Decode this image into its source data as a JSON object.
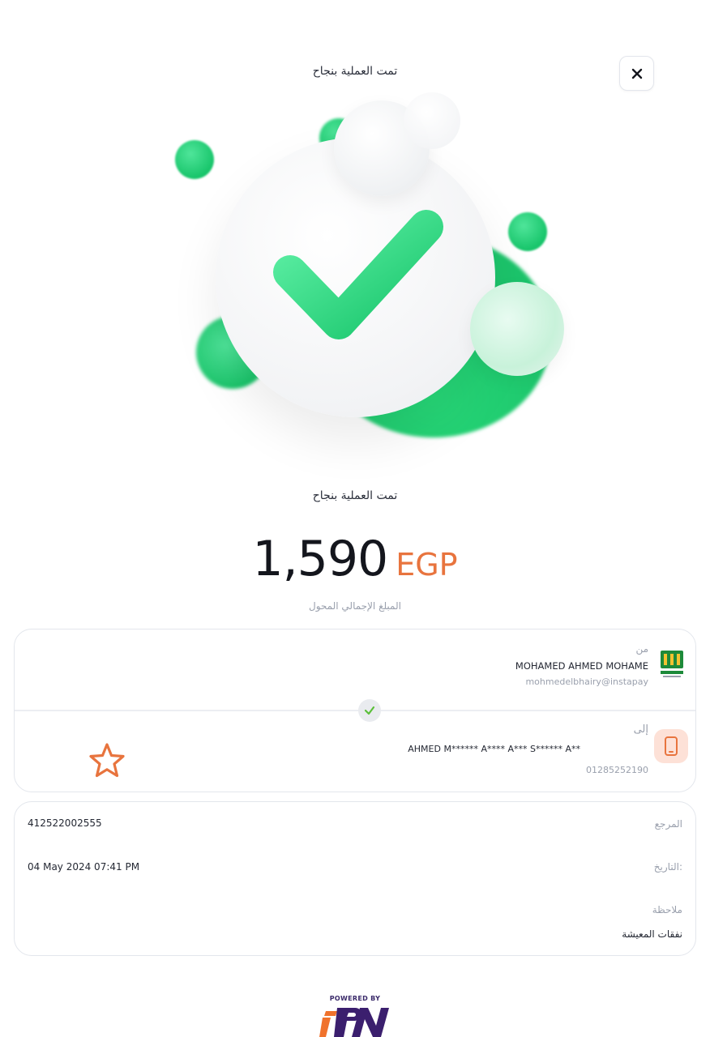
{
  "header": {
    "title": "تمت العملية بنجاح",
    "close_icon": "close-icon"
  },
  "status": {
    "message": "تمت العملية بنجاح",
    "icon": "success-checkmark-icon",
    "accent_color": "#1cc46b"
  },
  "amount": {
    "value": "1,590",
    "currency": "EGP",
    "currency_color": "#e8743e",
    "caption": "المبلغ الإجمالي المحول"
  },
  "from": {
    "label": "من",
    "name": "MOHAMED AHMED MOHAME",
    "address": "mohmedelbhairy@instapay",
    "bank_icon": "bank-logo-icon"
  },
  "to": {
    "label": "إلى",
    "name": "AHMED M****** A**** A*** S****** A**",
    "phone": "01285252190",
    "phone_icon": "mobile-phone-icon",
    "favorite_icon": "star-icon"
  },
  "details": {
    "reference_label": "المرجع",
    "reference_value": "412522002555",
    "date_label": "التاريخ:",
    "date_value": "04 May 2024 07:41 PM",
    "note_label": "ملاحظة",
    "note_value": "نفقات المعيشة"
  },
  "footer": {
    "powered_by": "POWERED BY",
    "brand_icon": "ipn-logo-icon"
  }
}
